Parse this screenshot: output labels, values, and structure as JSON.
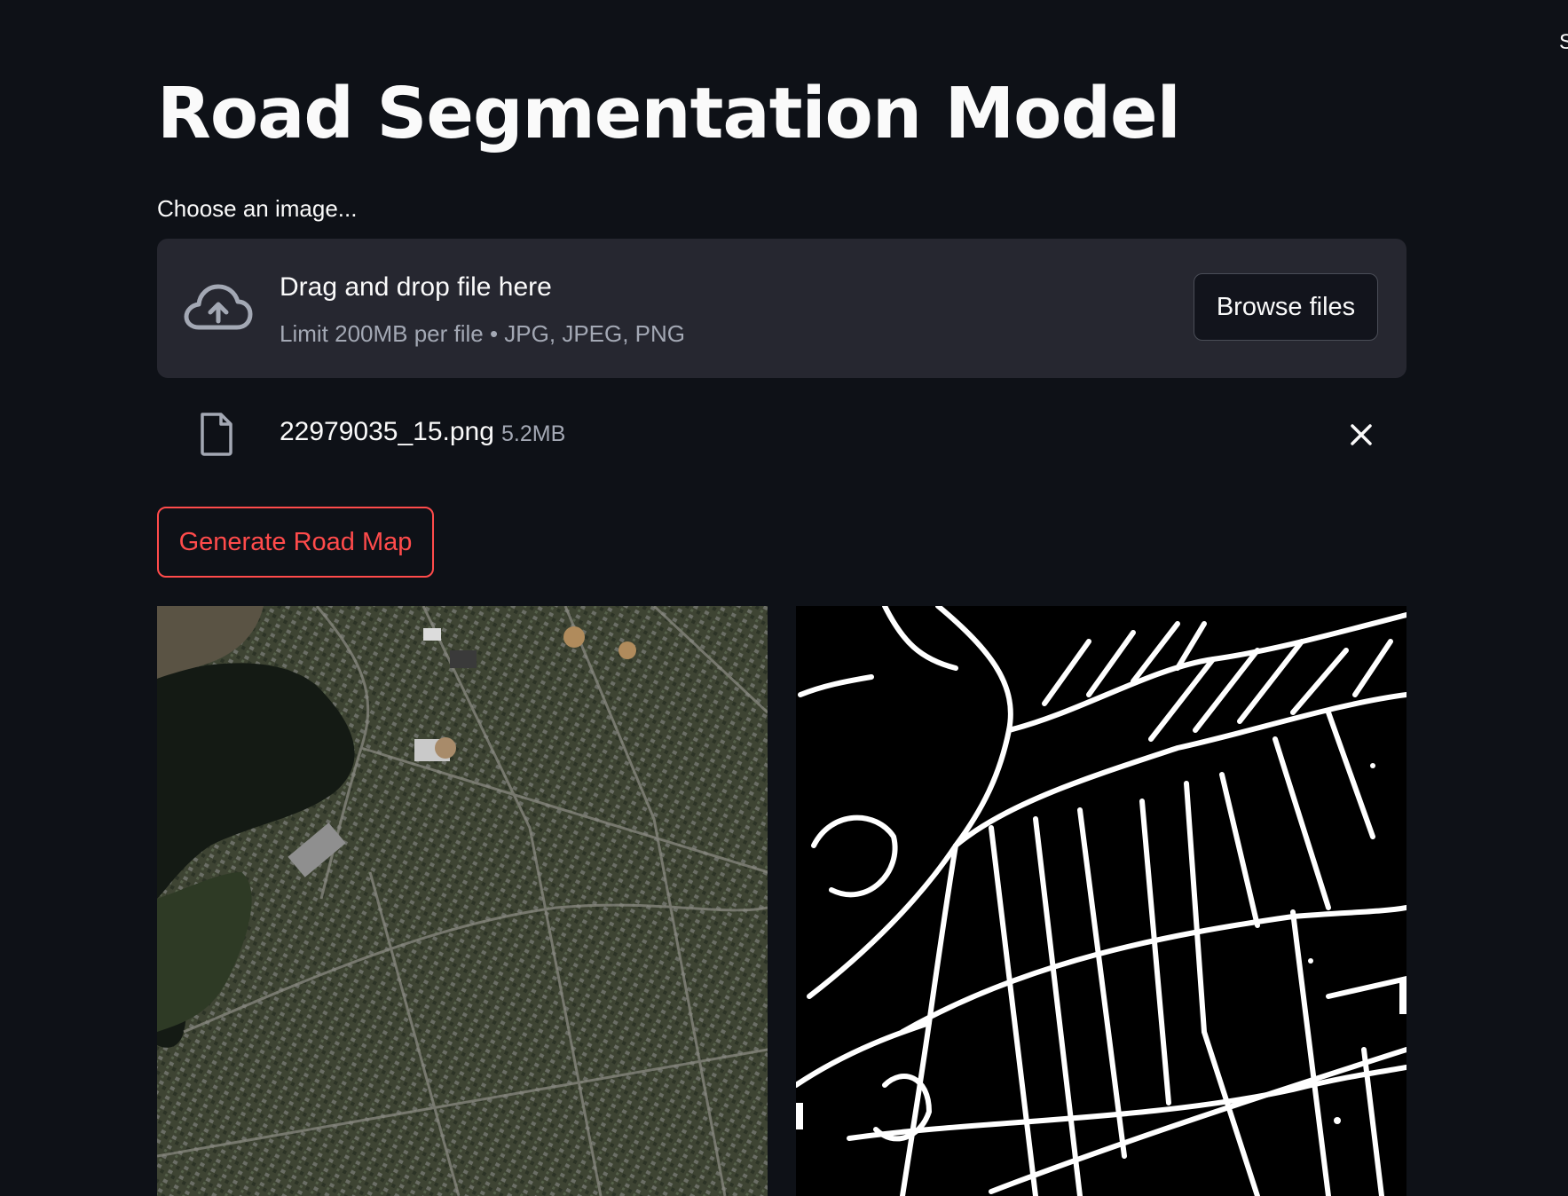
{
  "app": {
    "corner_text": "S",
    "title": "Road Segmentation Model"
  },
  "uploader": {
    "label": "Choose an image...",
    "drop_title": "Drag and drop file here",
    "limit_text": "Limit 200MB per file • JPG, JPEG, PNG",
    "browse_label": "Browse files",
    "icon": "cloud-upload-icon"
  },
  "uploaded_file": {
    "name": "22979035_15.png",
    "size": "5.2MB",
    "icon": "file-icon",
    "remove_icon": "close-icon"
  },
  "actions": {
    "generate_label": "Generate Road Map"
  },
  "images": {
    "input": {
      "kind": "satellite aerial photo"
    },
    "output": {
      "kind": "binary road mask"
    }
  },
  "colors": {
    "background": "#0e1117",
    "dropzone": "#262730",
    "accent": "#ff4b4b",
    "muted_text": "#a3a8b4"
  }
}
